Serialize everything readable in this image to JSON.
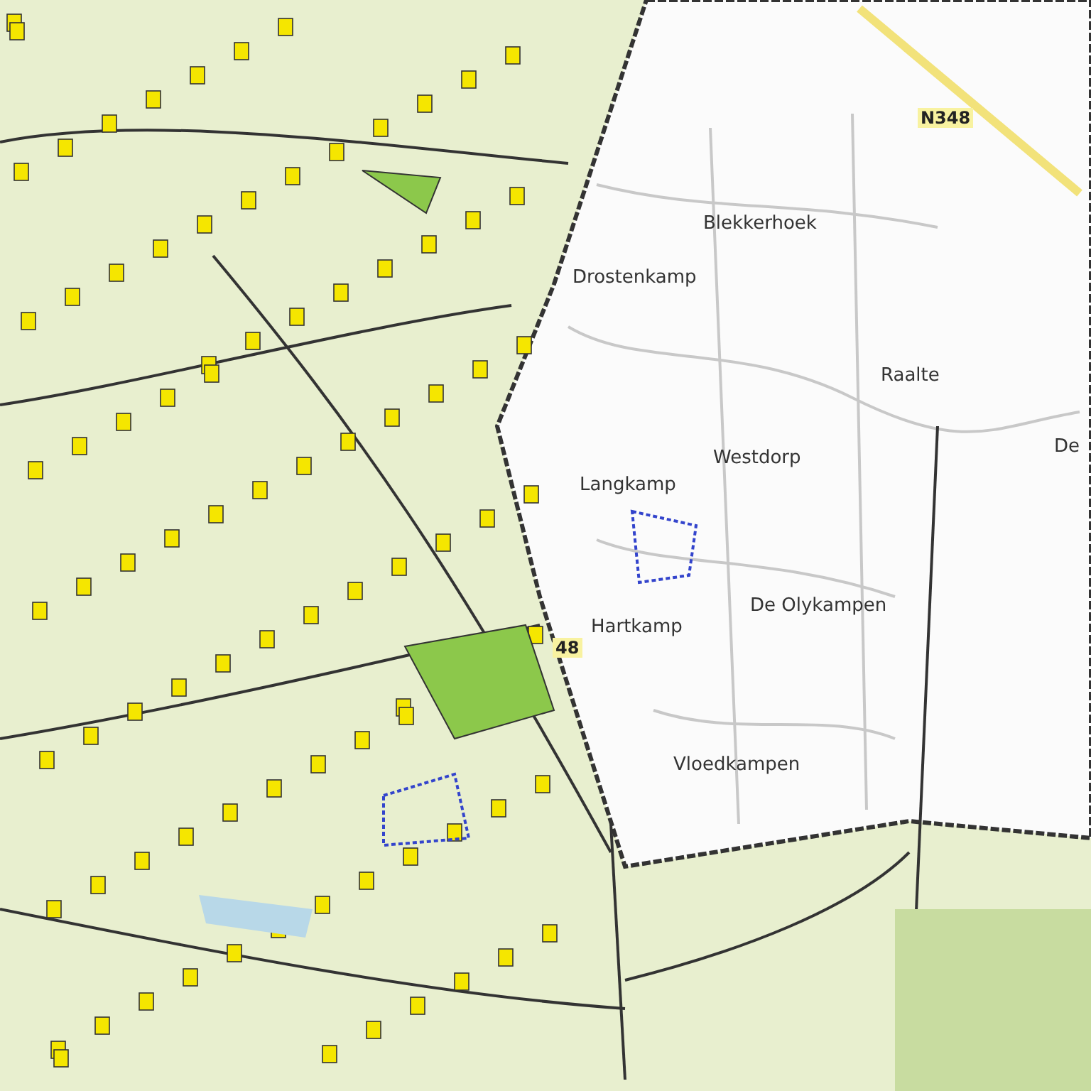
{
  "map": {
    "place_labels": [
      "Blekkerhoek",
      "Drostenkamp",
      "Raalte",
      "De",
      "Langkamp",
      "Westdorp",
      "De Olykampen",
      "Hartkamp",
      "Vloedkampen"
    ],
    "road_labels": [
      "N348",
      "48"
    ]
  }
}
